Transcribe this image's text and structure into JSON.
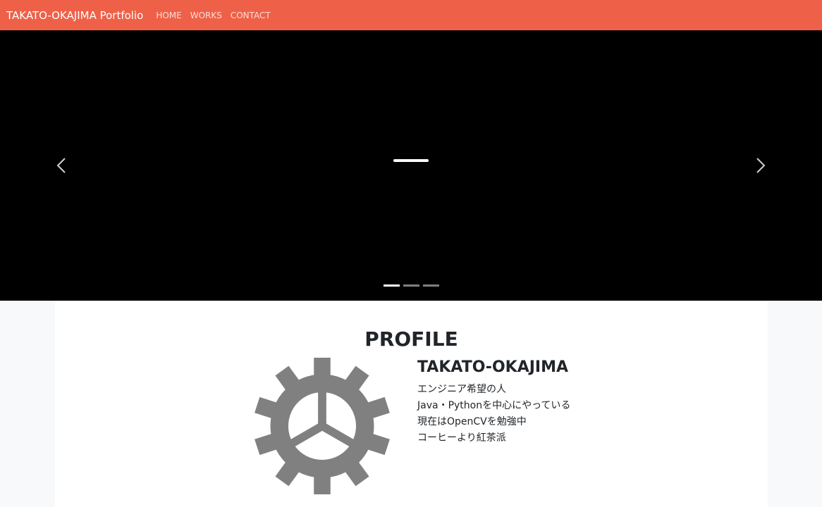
{
  "navbar": {
    "brand": "TAKATO-OKAJIMA Portfolio",
    "links": [
      "HOME",
      "WORKS",
      "CONTACT"
    ],
    "bg_color": "#ee6148"
  },
  "carousel": {
    "prev_icon": "chevron-left-icon",
    "next_icon": "chevron-right-icon",
    "indicator_count": 3,
    "active_indicator": 1
  },
  "profile": {
    "title": "PROFILE",
    "name": "TAKATO-OKAJIMA",
    "icon": "gear-icon",
    "bio": [
      "エンジニア希望の人",
      "Java・Pythonを中心にやっている",
      "現在はOpenCVを勉強中",
      "コーヒーより紅茶派"
    ]
  }
}
